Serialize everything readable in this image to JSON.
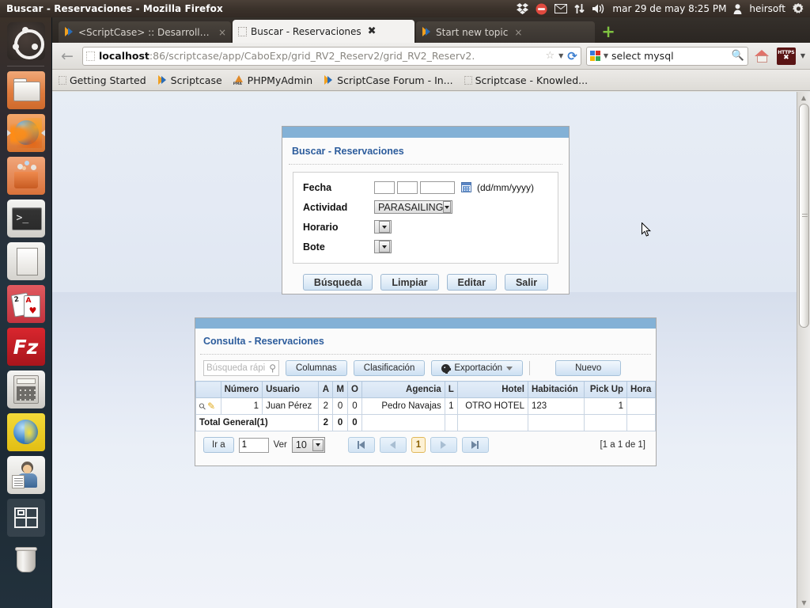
{
  "system": {
    "window_title": "Buscar - Reservaciones - Mozilla Firefox",
    "clock": "mar 29 de may  8:25 PM",
    "user": "heirsoft",
    "indicators": [
      "dropbox-icon",
      "do-not-disturb-icon",
      "mail-icon",
      "network-icon",
      "volume-icon",
      "gear-icon"
    ]
  },
  "launcher": {
    "items": [
      {
        "name": "ubuntu-dash-icon",
        "label": "Dash"
      },
      {
        "name": "files-icon",
        "label": "Files"
      },
      {
        "name": "firefox-icon",
        "label": "Firefox"
      },
      {
        "name": "ubuntu-software-icon",
        "label": "Ubuntu Software Center"
      },
      {
        "name": "terminal-icon",
        "label": "Terminal"
      },
      {
        "name": "libreoffice-writer-icon",
        "label": "LibreOffice Writer"
      },
      {
        "name": "solitaire-icon",
        "label": "Solitaire"
      },
      {
        "name": "filezilla-icon",
        "label": "FileZilla"
      },
      {
        "name": "calculator-icon",
        "label": "Calculator"
      },
      {
        "name": "seamonkey-icon",
        "label": "SeaMonkey"
      },
      {
        "name": "user-accounts-icon",
        "label": "Users"
      },
      {
        "name": "workspace-switcher-icon",
        "label": "Workspace Switcher"
      },
      {
        "name": "trash-icon",
        "label": "Trash"
      }
    ]
  },
  "browser": {
    "tabs": [
      {
        "title": "<ScriptCase> :: Desarrollo - ...",
        "active": false,
        "favicon": "scriptcase-icon",
        "close": "×"
      },
      {
        "title": "Buscar - Reservaciones",
        "active": true,
        "favicon": "blank-page-icon",
        "close": "✖"
      },
      {
        "title": "Start new topic",
        "active": false,
        "favicon": "scriptcase-icon",
        "close": "×"
      }
    ],
    "new_tab_label": "+",
    "url_host": "localhost",
    "url_path": ":86/scriptcase/app/CaboExp/grid_RV2_Reserv2/grid_RV2_Reserv2.",
    "search_value": "select mysql",
    "bookmarks": [
      {
        "label": "Getting Started",
        "icon": "blank-page-icon"
      },
      {
        "label": "Scriptcase",
        "icon": "scriptcase-icon"
      },
      {
        "label": "PHPMyAdmin",
        "icon": "phpmyadmin-icon"
      },
      {
        "label": "ScriptCase Forum - In...",
        "icon": "scriptcase-icon"
      },
      {
        "label": "Scriptcase - Knowled...",
        "icon": "blank-page-icon"
      }
    ]
  },
  "search_panel": {
    "title": "Buscar - Reservaciones",
    "fields": [
      {
        "label": "Fecha",
        "type": "date",
        "day": "",
        "month": "",
        "year": "",
        "hint": "(dd/mm/yyyy)"
      },
      {
        "label": "Actividad",
        "type": "select",
        "value": "PARASAILING"
      },
      {
        "label": "Horario",
        "type": "select",
        "value": ""
      },
      {
        "label": "Bote",
        "type": "select",
        "value": ""
      }
    ],
    "buttons": [
      {
        "label": "Búsqueda"
      },
      {
        "label": "Limpiar"
      },
      {
        "label": "Editar"
      },
      {
        "label": "Salir"
      }
    ]
  },
  "grid_panel": {
    "title": "Consulta - Reservaciones",
    "toolbar": {
      "quick_search_placeholder": "Búsqueda rápi",
      "columns_label": "Columnas",
      "classification_label": "Clasificación",
      "export_label": "Exportación",
      "new_label": "Nuevo"
    },
    "columns": [
      "",
      "Número",
      "Usuario",
      "A",
      "M",
      "O",
      "Agencia",
      "L",
      "Hotel",
      "Habitación",
      "Pick Up",
      "Hora"
    ],
    "rows": [
      {
        "actions": [
          "view-icon",
          "edit-icon"
        ],
        "numero": "1",
        "usuario": "Juan Pérez",
        "a": "2",
        "m": "0",
        "o": "0",
        "agencia": "Pedro Navajas",
        "l": "1",
        "hotel": "OTRO HOTEL",
        "habitacion": "123",
        "pickup": "1",
        "hora": ""
      }
    ],
    "total_row": {
      "label": "Total General(1)",
      "a": "2",
      "m": "0",
      "o": "0"
    },
    "pager": {
      "goto_label": "Ir a",
      "page_value": "1",
      "view_label": "Ver",
      "per_page": "10",
      "first_icon": "first-page-icon",
      "prev_icon": "previous-page-icon",
      "current_page": "1",
      "next_icon": "next-page-icon",
      "last_icon": "last-page-icon",
      "range_text": "[1 a 1 de 1]"
    }
  }
}
